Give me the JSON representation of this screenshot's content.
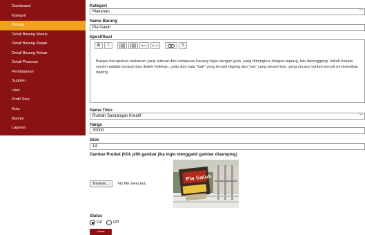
{
  "sidebar": {
    "items": [
      {
        "label": "Dashboard"
      },
      {
        "label": "Kategori"
      },
      {
        "label": "Barang"
      },
      {
        "label": "Detail Barang Masuk"
      },
      {
        "label": "Detail Barang Rusak"
      },
      {
        "label": "Detail Barang Keluar"
      },
      {
        "label": "Detail Pesanan"
      },
      {
        "label": "Pembayaran"
      },
      {
        "label": "Supplier"
      },
      {
        "label": "User"
      },
      {
        "label": "Profil Toko"
      },
      {
        "label": "Kota"
      },
      {
        "label": "Banner"
      },
      {
        "label": "Laporan"
      }
    ],
    "active_item": "Barang",
    "background_color": "#8b1212",
    "active_color": "#f0a21f"
  },
  "form": {
    "kategori": {
      "label": "Kategori",
      "value": "Makanan"
    },
    "nama_barang": {
      "label": "Nama Barang",
      "value": "Pia Galuh"
    },
    "spesifikasi": {
      "label": "Spesifikasi",
      "toolbar": [
        "B",
        "I",
        "ordered-list-icon",
        "unordered-list-icon",
        "outdent-icon",
        "indent-icon",
        "link-icon",
        "?"
      ],
      "content": "Bakpia merupakan makanan yang terbuat dari campuran kacang hijau dengan gula, yang dibungkus dengan tepung, lalu dipanggang. Istilah bakpia sendiri adalah berasal dari dialek Hokkian, yaitu dari kata \"bak\" yang berarti daging dan \"pia\" yang berarti kue, yang secara harfiah berarti roti berisikan daging."
    },
    "nama_toko": {
      "label": "Nama Toko",
      "value": "Rumah Sasirangan Kreatif"
    },
    "harga": {
      "label": "Harga",
      "value": "30000"
    },
    "stok": {
      "label": "Stok",
      "value": "14"
    },
    "gambar": {
      "label": "Gambar Produk (Klik pilih gambar jika ingin mengganti gambar disamping)",
      "browse_label": "Browse...",
      "file_status": "No file selected.",
      "image_text": "Pia Galuh"
    },
    "status": {
      "label": "Status",
      "options": [
        "On",
        "Off"
      ],
      "selected": "On"
    },
    "submit_label": "Update"
  }
}
